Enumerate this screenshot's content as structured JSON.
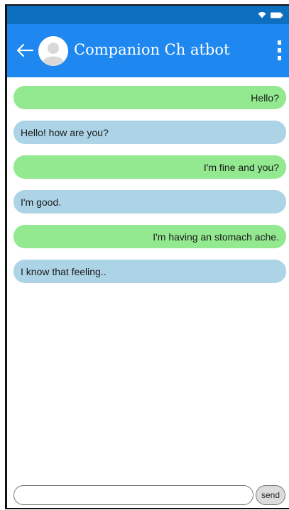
{
  "status_bar": {
    "icons": [
      "wifi-icon",
      "battery-icon"
    ]
  },
  "header": {
    "title": "Companion Ch atbot",
    "icons": [
      "back-arrow-icon",
      "avatar",
      "more-vertical-icon"
    ],
    "colors": {
      "status_bar": "#0c6fc0",
      "app_bar": "#1e88f0"
    }
  },
  "messages": [
    {
      "sender": "user",
      "text": "Hello?"
    },
    {
      "sender": "bot",
      "text": "Hello! how are you?"
    },
    {
      "sender": "user",
      "text": "I'm fine and you?"
    },
    {
      "sender": "bot",
      "text": "I'm good."
    },
    {
      "sender": "user",
      "text": "I'm having an stomach ache."
    },
    {
      "sender": "bot",
      "text": "I know that feeling.."
    }
  ],
  "bubble_colors": {
    "user": "#92e98f",
    "bot": "#acd4e6"
  },
  "composer": {
    "input_value": "",
    "input_placeholder": "",
    "send_label": "send"
  }
}
